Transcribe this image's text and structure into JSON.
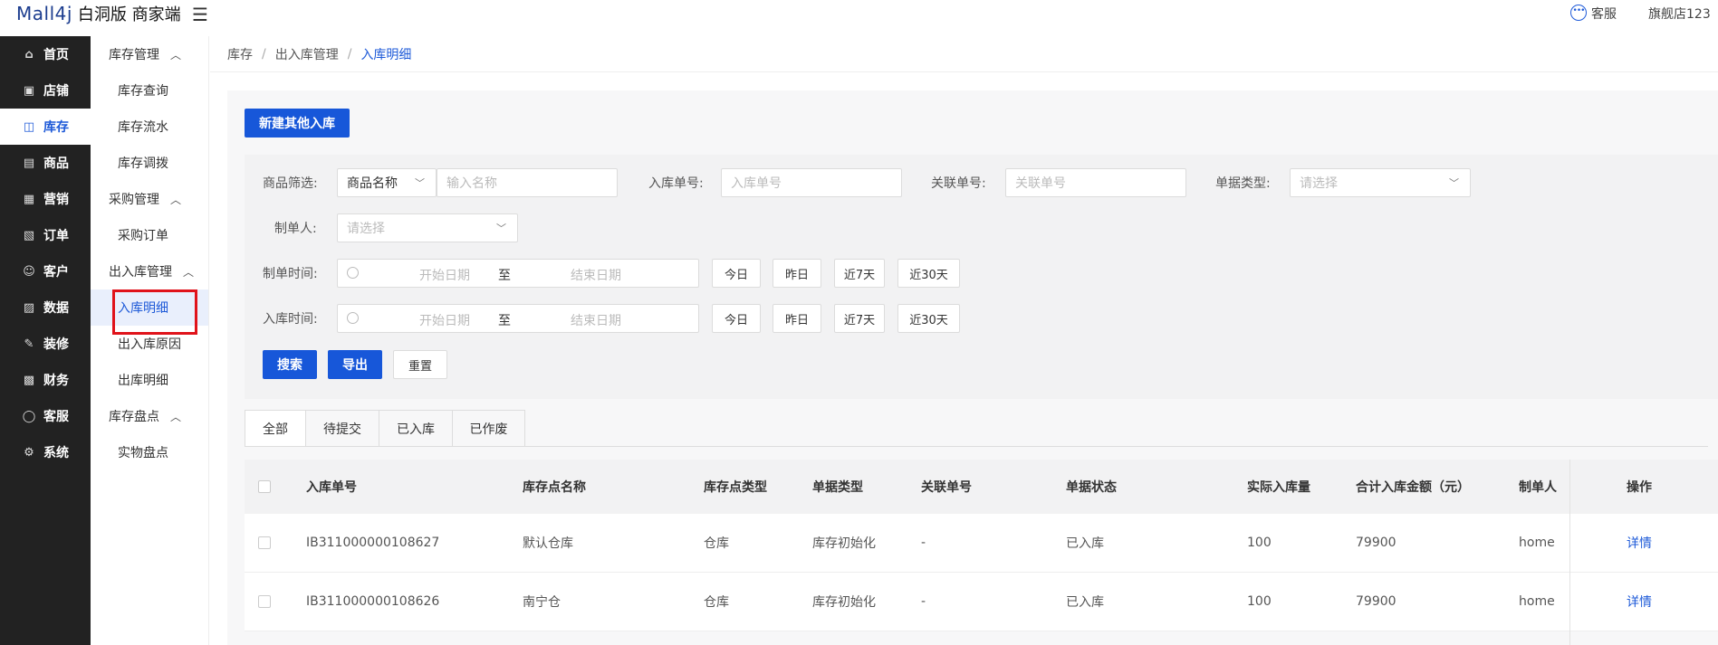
{
  "header": {
    "logo": "Mall4j",
    "edition": "白洞版 商家端",
    "menu_toggle": "☰",
    "customer_service": "客服",
    "store_name": "旗舰店123"
  },
  "nav": [
    {
      "label": "首页",
      "icon": "home-icon",
      "glyph": "⌂"
    },
    {
      "label": "店铺",
      "icon": "shop-icon",
      "glyph": "▣"
    },
    {
      "label": "库存",
      "icon": "inventory-icon",
      "glyph": "◫"
    },
    {
      "label": "商品",
      "icon": "product-icon",
      "glyph": "▤"
    },
    {
      "label": "营销",
      "icon": "gift-icon",
      "glyph": "▦"
    },
    {
      "label": "订单",
      "icon": "order-icon",
      "glyph": "▧"
    },
    {
      "label": "客户",
      "icon": "customer-icon",
      "glyph": "☺"
    },
    {
      "label": "数据",
      "icon": "data-icon",
      "glyph": "▨"
    },
    {
      "label": "装修",
      "icon": "decorate-icon",
      "glyph": "✎"
    },
    {
      "label": "财务",
      "icon": "finance-icon",
      "glyph": "▩"
    },
    {
      "label": "客服",
      "icon": "service-icon",
      "glyph": "◯"
    },
    {
      "label": "系统",
      "icon": "settings-icon",
      "glyph": "⚙"
    }
  ],
  "submenu": {
    "g1": "库存管理",
    "g1_items": [
      "库存查询",
      "库存流水",
      "库存调拨"
    ],
    "g2": "采购管理",
    "g2_items": [
      "采购订单"
    ],
    "g3": "出入库管理",
    "g3_items": [
      "入库明细",
      "出入库原因",
      "出库明细"
    ],
    "g4": "库存盘点",
    "g4_items": [
      "实物盘点"
    ]
  },
  "breadcrumb": [
    "库存",
    "出入库管理",
    "入库明细"
  ],
  "actions": {
    "new_inbound": "新建其他入库"
  },
  "filters": {
    "product_filter_label": "商品筛选:",
    "product_filter_select": "商品名称",
    "product_name_placeholder": "输入名称",
    "inbound_no_label": "入库单号:",
    "inbound_no_placeholder": "入库单号",
    "related_no_label": "关联单号:",
    "related_no_placeholder": "关联单号",
    "doc_type_label": "单据类型:",
    "doc_type_placeholder": "请选择",
    "creator_label": "制单人:",
    "creator_placeholder": "请选择",
    "create_time_label": "制单时间:",
    "inbound_time_label": "入库时间:",
    "start_date": "开始日期",
    "to": "至",
    "end_date": "结束日期",
    "quick": [
      "今日",
      "昨日",
      "近7天",
      "近30天"
    ],
    "search": "搜索",
    "export": "导出",
    "reset": "重置"
  },
  "tabs": [
    "全部",
    "待提交",
    "已入库",
    "已作废"
  ],
  "table": {
    "columns": [
      "入库单号",
      "库存点名称",
      "库存点类型",
      "单据类型",
      "关联单号",
      "单据状态",
      "实际入库量",
      "合计入库金额（元）",
      "制单人",
      "操作"
    ],
    "rows": [
      [
        "IB311000000108627",
        "默认仓库",
        "仓库",
        "库存初始化",
        "-",
        "已入库",
        "100",
        "79900",
        "home",
        "详情"
      ],
      [
        "IB311000000108626",
        "南宁仓",
        "仓库",
        "库存初始化",
        "-",
        "已入库",
        "100",
        "79900",
        "home",
        "详情"
      ]
    ]
  },
  "colors": {
    "accent": "#1757d9",
    "nav_bg": "#222222",
    "highlight_border": "#e0121a"
  }
}
